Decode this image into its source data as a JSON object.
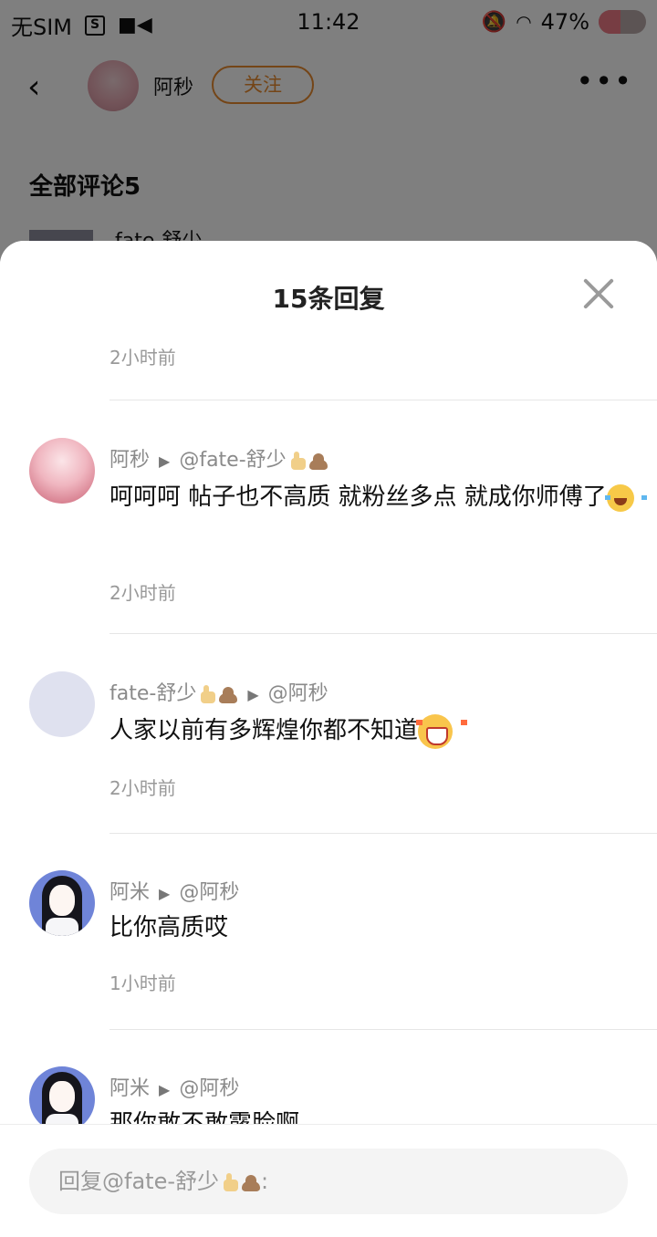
{
  "status_bar": {
    "carrier": "无SIM",
    "time": "11:42",
    "battery_percent": "47%",
    "battery_level": 0.47,
    "icons": [
      "sim-status-icon",
      "video-icon",
      "mute-icon",
      "wifi-icon",
      "battery-icon"
    ]
  },
  "background_page": {
    "author_name": "阿秒",
    "follow_label": "关注",
    "more_label": "•••",
    "comments_heading": "全部评论5",
    "peek_text": "fate-舒少"
  },
  "sheet": {
    "title": "15条回复",
    "clipped_time": "2小时前",
    "replies": [
      {
        "author": "阿秒",
        "target": "@fate-舒少",
        "target_emojis": [
          "thumbs-up-emoji",
          "poop-emoji"
        ],
        "text": "呵呵呵 帖子也不高质 就粉丝多点 就成你师傅了",
        "text_emoji": "laughing-tears-emoji",
        "time": "2小时前",
        "avatar": "pink-anime-avatar"
      },
      {
        "author": "fate-舒少",
        "author_emojis": [
          "thumbs-up-emoji",
          "poop-emoji"
        ],
        "target": "@阿秒",
        "text": "人家以前有多辉煌你都不知道",
        "text_emoji": "crying-emoji",
        "time": "2小时前",
        "avatar": "blank-avatar"
      },
      {
        "author": "阿米",
        "target": "@阿秒",
        "text": "比你高质哎",
        "time": "1小时前",
        "avatar": "anime-girl-avatar"
      },
      {
        "author": "阿米",
        "target": "@阿秒",
        "text": "那你敢不敢露脸啊",
        "avatar": "anime-girl-avatar"
      }
    ]
  },
  "input": {
    "placeholder_prefix": "回复@fate-舒少",
    "placeholder_suffix": ":"
  }
}
